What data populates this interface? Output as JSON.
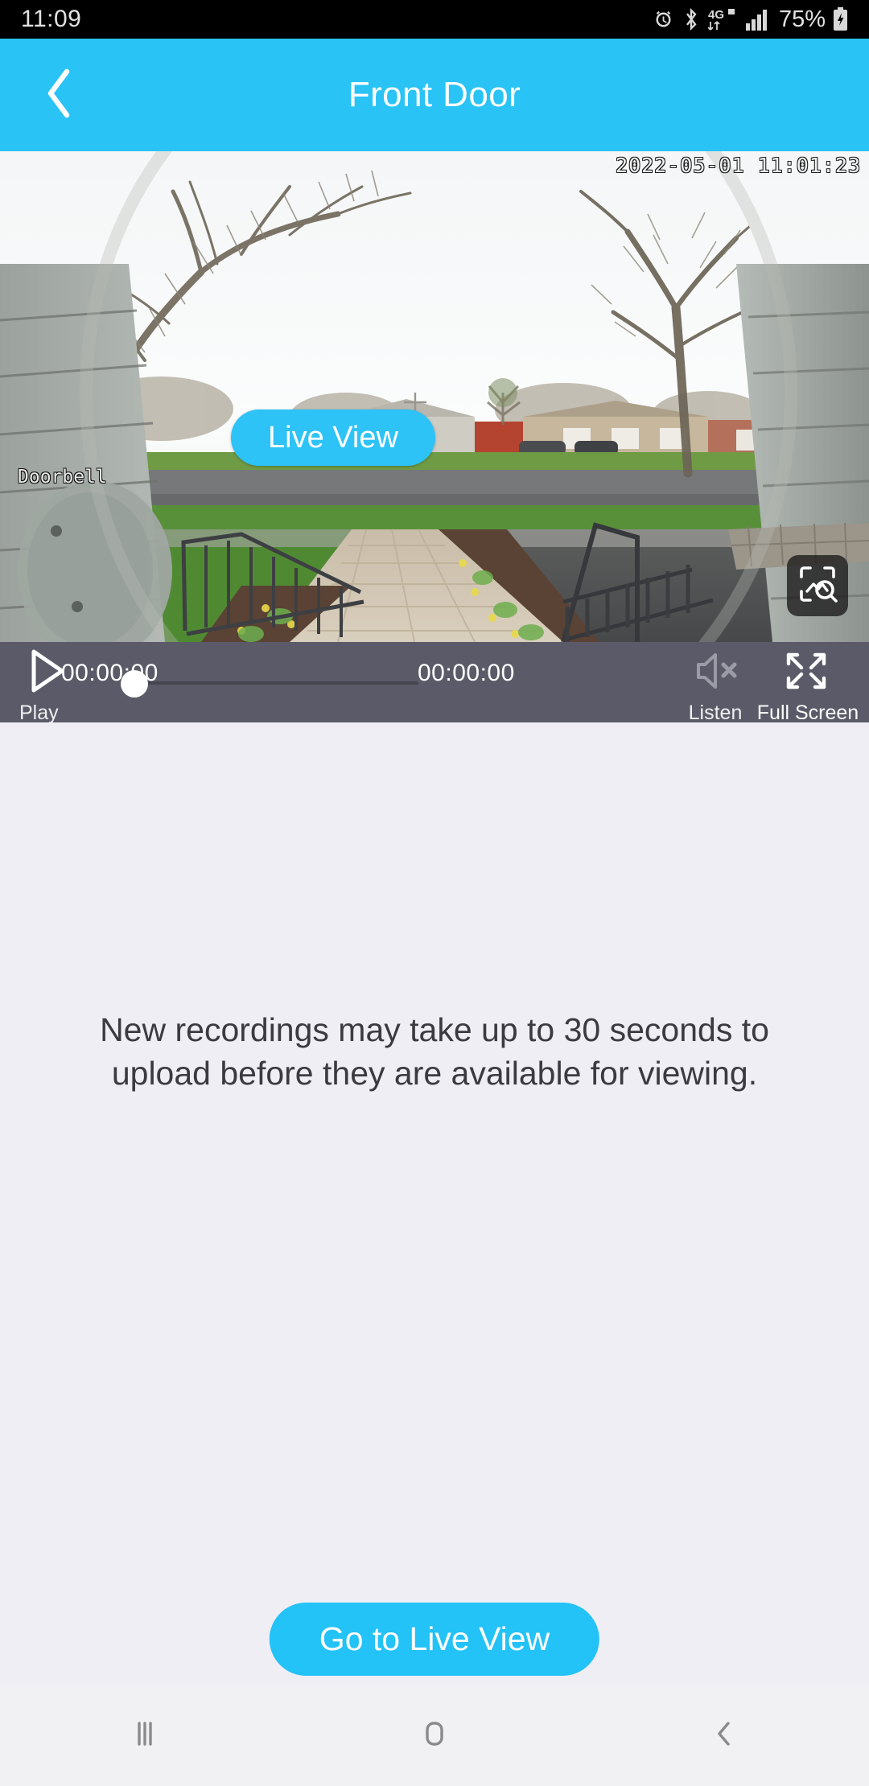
{
  "status_bar": {
    "time": "11:09",
    "battery_percent": "75%",
    "network": "4G",
    "icons": [
      "alarm-icon",
      "bluetooth-icon",
      "network-4g-icon",
      "signal-bars-icon",
      "battery-charging-icon"
    ]
  },
  "header": {
    "title": "Front Door",
    "back_icon": "chevron-left-icon",
    "bg_color": "#29c3f5"
  },
  "video": {
    "timestamp_overlay": "2022-05-01 11:01:23",
    "camera_label": "Doorbell",
    "live_view_pill": "Live View",
    "snapshot_icon": "image-search-icon"
  },
  "controls": {
    "play_icon": "play-icon",
    "play_label": "Play",
    "current_time": "00:00:00",
    "total_time": "00:00:00",
    "progress_percent": 0,
    "listen_icon": "speaker-muted-icon",
    "listen_label": "Listen",
    "fullscreen_icon": "fullscreen-expand-icon",
    "fullscreen_label": "Full Screen",
    "bg_color": "#5b5a68"
  },
  "main": {
    "empty_message": "New recordings may take up to 30 seconds to upload before they are available for viewing.",
    "go_live_button": "Go to Live View",
    "accent_color": "#23c2f7",
    "bg_color": "#efeef4"
  },
  "navbar": {
    "recents_icon": "recents-icon",
    "home_icon": "home-icon",
    "back_icon": "back-chevron-icon"
  }
}
